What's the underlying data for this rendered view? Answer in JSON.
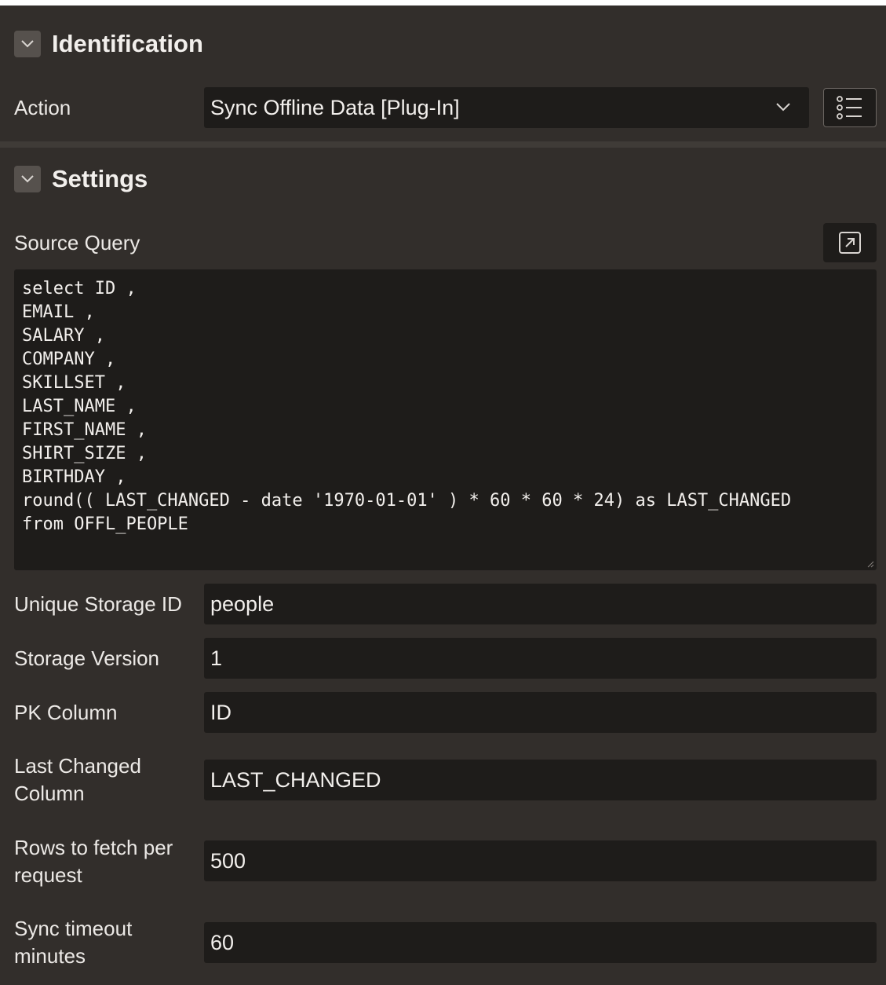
{
  "identification": {
    "title": "Identification",
    "action_label": "Action",
    "action_value": "Sync Offline Data [Plug-In]"
  },
  "settings": {
    "title": "Settings",
    "source_query_label": "Source Query",
    "source_query_lines": [
      "select ID ,",
      "EMAIL ,",
      "SALARY ,",
      "COMPANY ,",
      "SKILLSET ,",
      "LAST_NAME ,",
      "FIRST_NAME ,",
      "SHIRT_SIZE ,",
      "BIRTHDAY ,",
      "round(( LAST_CHANGED - date '1970-01-01' ) * 60 * 60 * 24) as LAST_CHANGED",
      "from OFFL_PEOPLE"
    ],
    "fields": [
      {
        "label": "Unique Storage ID",
        "value": "people"
      },
      {
        "label": "Storage Version",
        "value": "1"
      },
      {
        "label": "PK Column",
        "value": "ID"
      },
      {
        "label": "Last Changed Column",
        "value": "LAST_CHANGED"
      },
      {
        "label": "Rows to fetch per request",
        "value": "500"
      },
      {
        "label": "Sync timeout minutes",
        "value": "60"
      }
    ]
  },
  "icons": {
    "collapse": "chevron-down-icon",
    "select_open": "chevron-down-icon",
    "list_values": "list-icon",
    "expand_editor": "expand-icon"
  }
}
